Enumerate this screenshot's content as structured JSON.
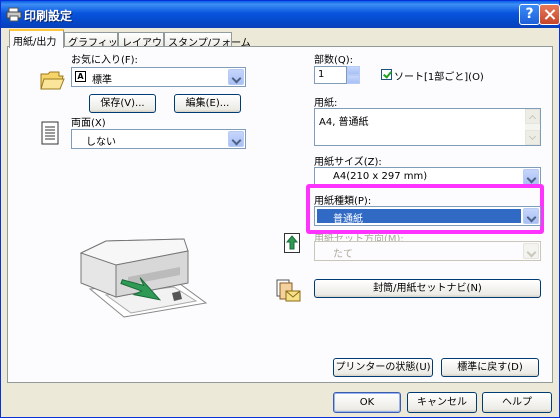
{
  "window": {
    "title": "印刷設定"
  },
  "tabs": [
    {
      "label": "用紙/出力"
    },
    {
      "label": "グラフィックス"
    },
    {
      "label": "レイアウト"
    },
    {
      "label": "スタンプ/フォーム"
    }
  ],
  "favorites": {
    "label": "お気に入り(F):",
    "value": "標準",
    "value_icon_char": "A",
    "save_button": "保存(V)...",
    "edit_button": "編集(E)..."
  },
  "duplex": {
    "label": "両面(X)",
    "value": "しない"
  },
  "copies": {
    "label": "部数(Q):",
    "value": "1",
    "collate_label": "ソート[1部ごと](O)",
    "collate_checked": true
  },
  "paper": {
    "label": "用紙:",
    "summary": "A4, 普通紙"
  },
  "paper_size": {
    "label": "用紙サイズ(Z):",
    "value": "A4(210 x 297 mm)"
  },
  "paper_type": {
    "label": "用紙種類(P):",
    "value": "普通紙"
  },
  "paper_orientation": {
    "label": "用紙セット方向(M):",
    "value": "たて"
  },
  "paper_guide_button": "封筒/用紙セットナビ(N)",
  "printer_status_button": "プリンターの状態(U)",
  "restore_defaults_button": "標準に戻す(D)",
  "dialog_buttons": {
    "ok": "OK",
    "cancel": "キャンセル",
    "help": "ヘルプ"
  },
  "colors": {
    "highlight": "#ff33ff",
    "selection": "#316ac5",
    "titlebar": "#0855dd"
  }
}
